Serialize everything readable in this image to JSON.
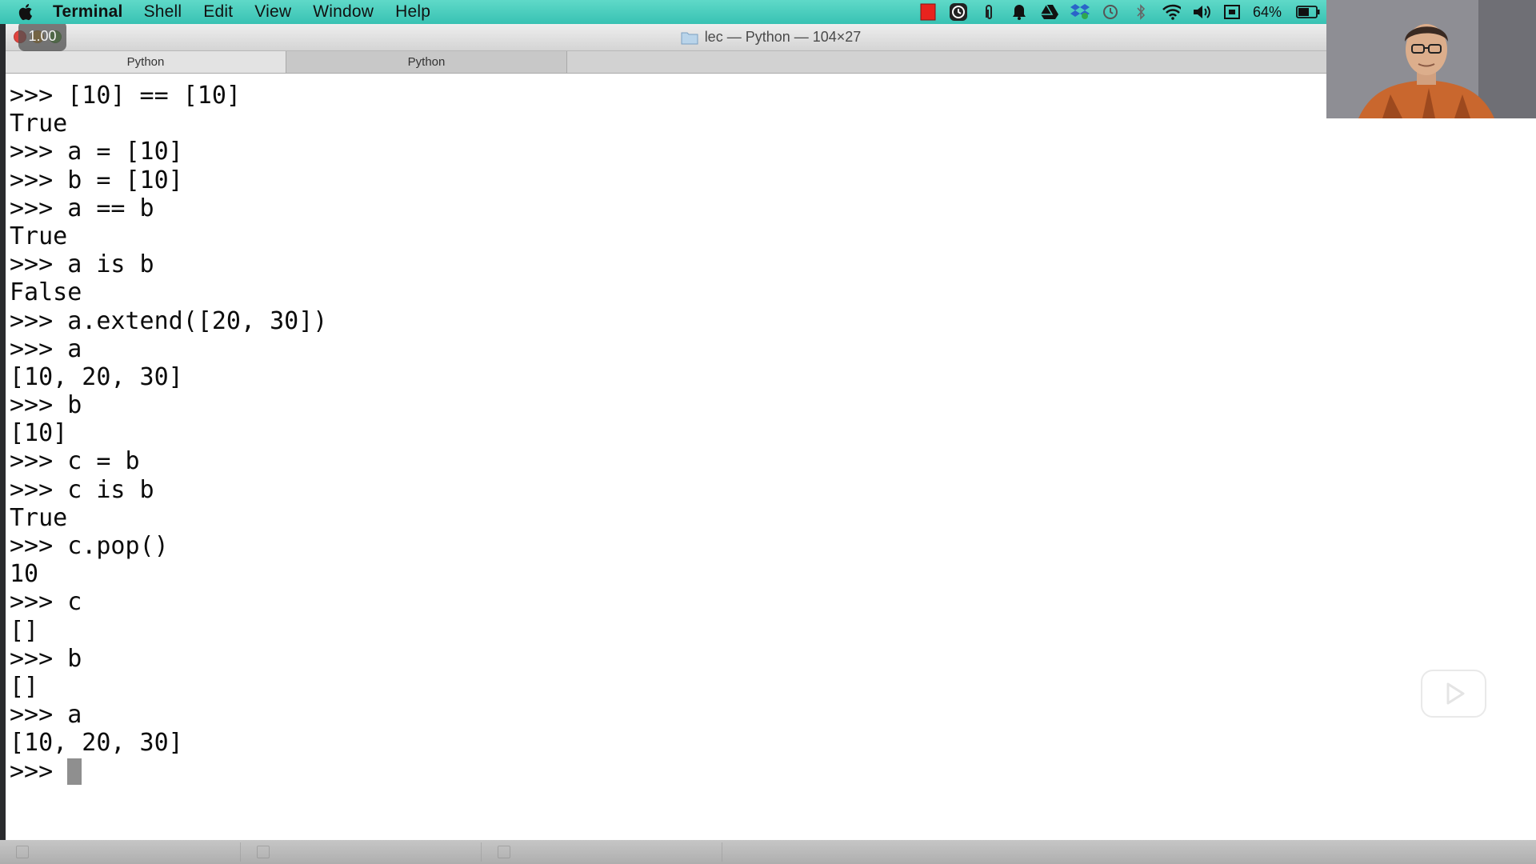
{
  "menubar": {
    "app_name": "Terminal",
    "items": [
      "Shell",
      "Edit",
      "View",
      "Window",
      "Help"
    ],
    "battery_percent": "64%",
    "status_icons": [
      "stop-icon",
      "clock-badge-icon",
      "paperclip-icon",
      "bell-icon",
      "drive-icon",
      "dropbox-icon",
      "time-machine-icon",
      "bluetooth-icon",
      "wifi-icon",
      "volume-icon",
      "display-icon",
      "battery-icon"
    ]
  },
  "window": {
    "title": "lec — Python — 104×27",
    "playback_speed": "1.00",
    "tabs": [
      {
        "label": "Python",
        "active": true
      },
      {
        "label": "Python",
        "active": false
      }
    ]
  },
  "terminal": {
    "lines": [
      ">>> [10] == [10]",
      "True",
      ">>> a = [10]",
      ">>> b = [10]",
      ">>> a == b",
      "True",
      ">>> a is b",
      "False",
      ">>> a.extend([20, 30])",
      ">>> a",
      "[10, 20, 30]",
      ">>> b",
      "[10]",
      ">>> c = b",
      ">>> c is b",
      "True",
      ">>> c.pop()",
      "10",
      ">>> c",
      "[]",
      ">>> b",
      "[]",
      ">>> a",
      "[10, 20, 30]"
    ],
    "prompt": ">>> "
  },
  "colors": {
    "menubar": "#48cdbd",
    "terminal_bg": "#ffffff",
    "terminal_text": "#0c0c0c",
    "cursor": "#8f8f8f"
  }
}
